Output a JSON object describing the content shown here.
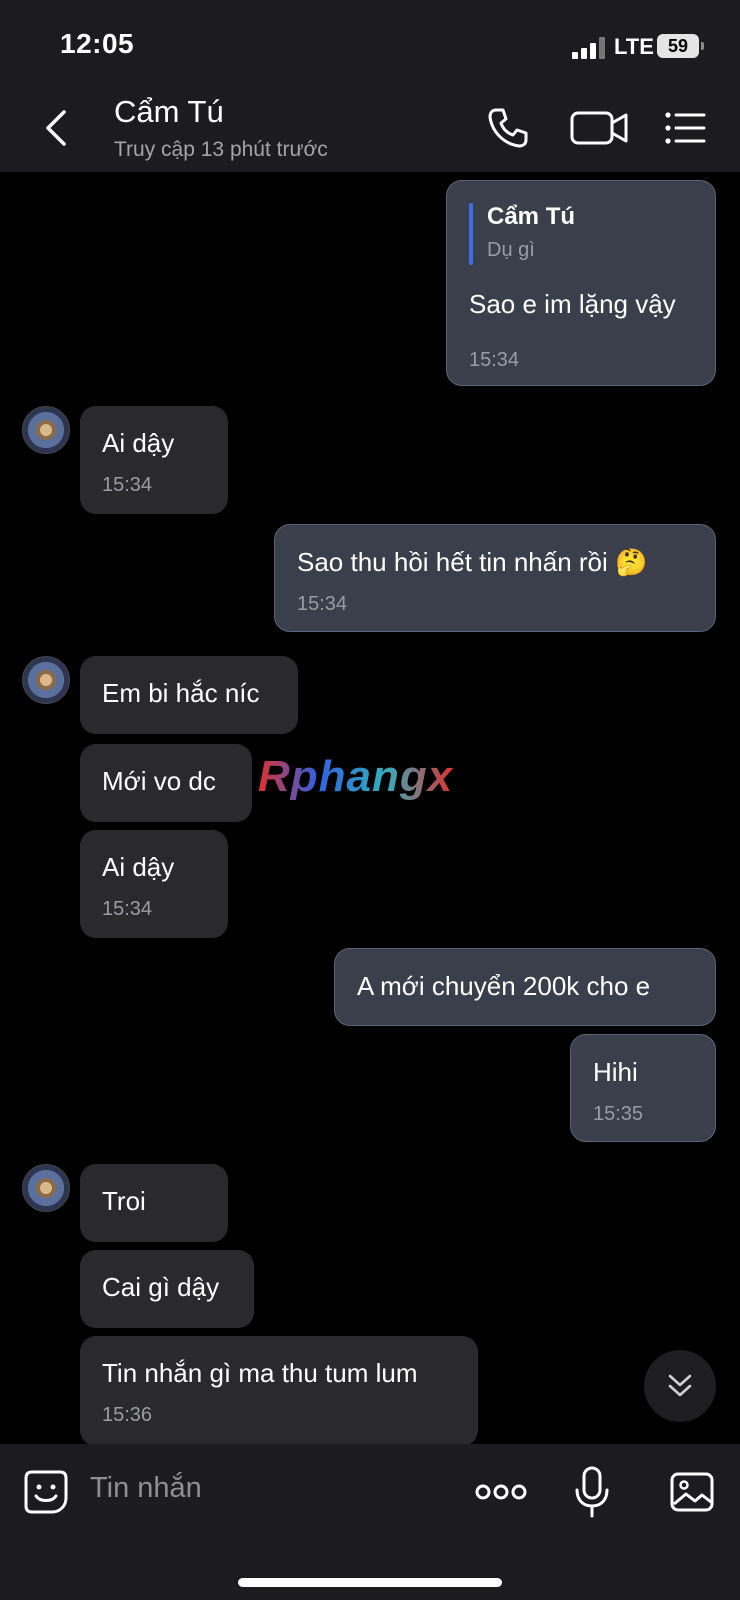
{
  "status_bar": {
    "time": "12:05",
    "network": "LTE",
    "battery": "59"
  },
  "header": {
    "name": "Cẩm Tú",
    "status": "Truy cập 13 phút trước",
    "icons": [
      "back-icon",
      "phone-icon",
      "video-icon",
      "menu-icon"
    ]
  },
  "messages": [
    {
      "dir": "out",
      "quote_name": "Cẩm Tú",
      "quote_text": "Dụ gì",
      "text": "Sao e im lặng vậy",
      "time": "15:34"
    },
    {
      "dir": "in",
      "text": "Ai dậy",
      "time": "15:34"
    },
    {
      "dir": "out",
      "text": "Sao thu hồi hết tin nhấn rồi",
      "emoji": "🤔",
      "time": "15:34"
    },
    {
      "dir": "in",
      "text": "Em bi hắc níc"
    },
    {
      "dir": "in",
      "text": "Mới vo dc"
    },
    {
      "dir": "in",
      "text": "Ai dậy",
      "time": "15:34"
    },
    {
      "dir": "out",
      "text": "A mới chuyển 200k cho e"
    },
    {
      "dir": "out",
      "text": "Hihi",
      "time": "15:35"
    },
    {
      "dir": "in",
      "text": "Troi"
    },
    {
      "dir": "in",
      "text": "Cai gì dậy"
    },
    {
      "dir": "in",
      "text": "Tin nhắn gì ma thu tum lum",
      "time": "15:36"
    }
  ],
  "watermark": "Rphangx",
  "composer": {
    "placeholder": "Tin nhắn",
    "icons": [
      "sticker-icon",
      "more-icon",
      "microphone-icon",
      "image-icon"
    ]
  },
  "colors": {
    "incoming_bubble": "#2a2a2c",
    "outgoing_bubble": "#3a3f4b",
    "quote_accent": "#3b6fe0"
  }
}
